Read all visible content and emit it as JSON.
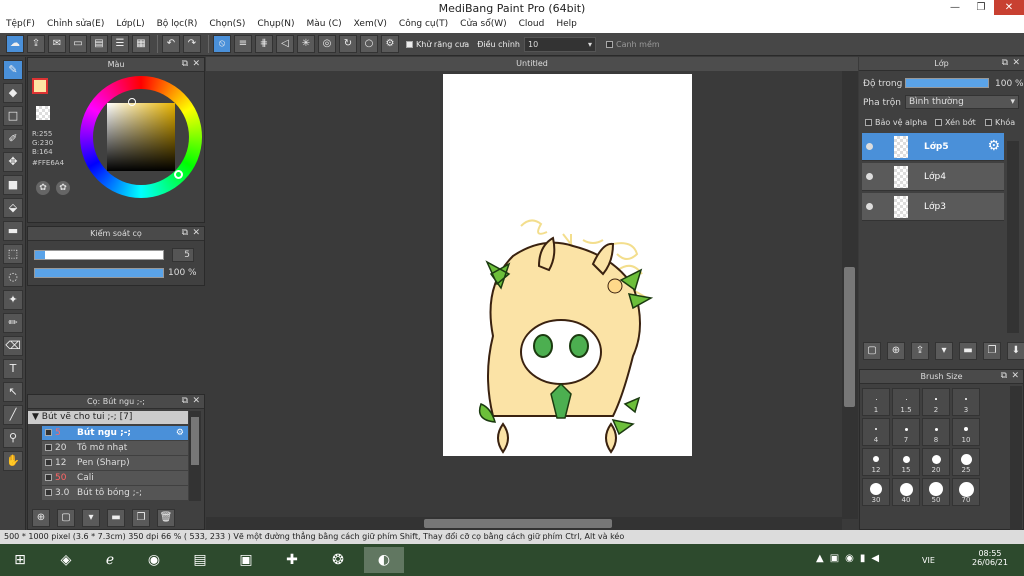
{
  "window": {
    "title": "MediBang Paint Pro (64bit)"
  },
  "menu": [
    "Tệp(F)",
    "Chỉnh sửa(E)",
    "Lớp(L)",
    "Bộ lọc(R)",
    "Chọn(S)",
    "Chụp(N)",
    "Màu (C)",
    "Xem(V)",
    "Công cụ(T)",
    "Cửa sổ(W)",
    "Cloud",
    "Help"
  ],
  "toolbar": {
    "antialias_label": "Khử răng cưa",
    "correction_label": "Điều chỉnh",
    "correction_value": "10",
    "snap_label": "Canh mềm"
  },
  "color_panel": {
    "title": "Màu",
    "r": "R:255",
    "g": "G:230",
    "b": "B:164",
    "hex": "#FFE6A4",
    "fg_color": "#FFE6A4"
  },
  "brush_control": {
    "title": "Kiểm soát cọ",
    "size": "5",
    "opacity": "100 %"
  },
  "brush_panel": {
    "title": "Cọ: Bút ngu ;-;",
    "group": "Bút vẽ cho tui ;-; [7]",
    "items": [
      {
        "size": "5",
        "name": "Bút ngu ;-;"
      },
      {
        "size": "20",
        "name": "Tô mờ nhạt"
      },
      {
        "size": "12",
        "name": "Pen (Sharp)"
      },
      {
        "size": "50",
        "name": "Cali"
      },
      {
        "size": "3.0",
        "name": "Bút tô bóng ;-;"
      }
    ]
  },
  "document": {
    "tab": "Untitled"
  },
  "layer_panel": {
    "title": "Lớp",
    "opacity_label": "Độ trong",
    "opacity_value": "100 %",
    "blend_label": "Pha trộn",
    "blend_value": "Bình thường",
    "protect_alpha": "Bảo vệ alpha",
    "clipping": "Xén bớt",
    "lock": "Khóa",
    "layers": [
      "Lớp5",
      "Lớp4",
      "Lớp3"
    ]
  },
  "brush_size_panel": {
    "title": "Brush Size",
    "sizes": [
      "1",
      "1.5",
      "2",
      "3",
      "4",
      "7",
      "8",
      "10",
      "12",
      "15",
      "20",
      "25",
      "30",
      "40",
      "50",
      "70"
    ]
  },
  "status": {
    "text": "500 * 1000 pixel   (3.6 * 7.3cm)   350 dpi   66 %   ( 533, 233 )   Vẽ một đường thẳng bằng cách giữ phím Shift, Thay đổi cỡ cọ bằng cách giữ phím Ctrl, Alt và kéo"
  },
  "taskbar": {
    "lang": "VIE",
    "time": "08:55",
    "date": "26/06/21"
  }
}
